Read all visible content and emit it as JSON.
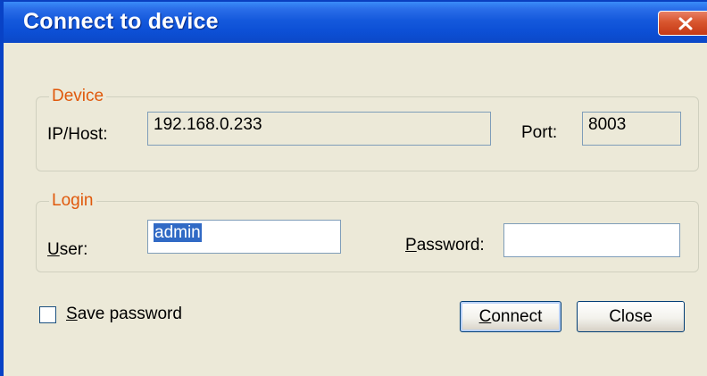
{
  "window": {
    "title": "Connect to device"
  },
  "device_group": {
    "legend": "Device",
    "host_label": "IP/Host:",
    "host_value": "192.168.0.233",
    "port_label": "Port:",
    "port_value": "8003"
  },
  "login_group": {
    "legend": "Login",
    "user_label_key": "U",
    "user_label_rest": "ser:",
    "user_value": "admin",
    "password_label_key": "P",
    "password_label_rest": "assword:",
    "password_value": ""
  },
  "options": {
    "save_password_key": "S",
    "save_password_rest": "ave password",
    "save_password_checked": false
  },
  "buttons": {
    "connect_key": "C",
    "connect_rest": "onnect",
    "close": "Close"
  },
  "colors": {
    "titlebar": "#0d50d6",
    "legend_text": "#e0590c",
    "dialog_face": "#ece9d8",
    "selection": "#316ac5"
  }
}
